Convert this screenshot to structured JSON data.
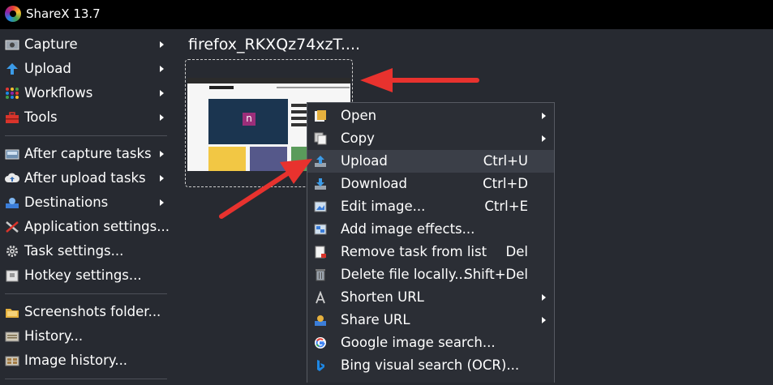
{
  "window": {
    "title": "ShareX 13.7"
  },
  "main_menu": [
    {
      "label": "Capture",
      "icon": "camera-icon",
      "submenu": true
    },
    {
      "label": "Upload",
      "icon": "upload-arrow-icon",
      "submenu": true
    },
    {
      "label": "Workflows",
      "icon": "workflows-grid-icon",
      "submenu": true
    },
    {
      "label": "Tools",
      "icon": "toolbox-icon",
      "submenu": true
    },
    {
      "label": "After capture tasks",
      "icon": "after-capture-icon",
      "submenu": true
    },
    {
      "label": "After upload tasks",
      "icon": "cloud-upload-icon",
      "submenu": true
    },
    {
      "label": "Destinations",
      "icon": "destinations-icon",
      "submenu": true
    },
    {
      "label": "Application settings...",
      "icon": "wrench-screwdriver-icon",
      "submenu": false
    },
    {
      "label": "Task settings...",
      "icon": "gear-icon",
      "submenu": false
    },
    {
      "label": "Hotkey settings...",
      "icon": "keyboard-icon",
      "submenu": false
    },
    {
      "label": "Screenshots folder...",
      "icon": "folder-icon",
      "submenu": false
    },
    {
      "label": "History...",
      "icon": "history-icon",
      "submenu": false
    },
    {
      "label": "Image history...",
      "icon": "image-history-icon",
      "submenu": false
    }
  ],
  "thumbnail": {
    "filename": "firefox_RKXQz74xzT....",
    "preview_brand": "Nerds Chalk",
    "preview_letter": "n"
  },
  "context_menu": [
    {
      "label": "Open",
      "shortcut": "",
      "icon": "open-folder-icon",
      "submenu": true
    },
    {
      "label": "Copy",
      "shortcut": "",
      "icon": "copy-icon",
      "submenu": true
    },
    {
      "label": "Upload",
      "shortcut": "Ctrl+U",
      "icon": "upload-icon",
      "submenu": false,
      "highlighted": true
    },
    {
      "label": "Download",
      "shortcut": "Ctrl+D",
      "icon": "download-icon",
      "submenu": false
    },
    {
      "label": "Edit image...",
      "shortcut": "Ctrl+E",
      "icon": "edit-image-icon",
      "submenu": false
    },
    {
      "label": "Add image effects...",
      "shortcut": "",
      "icon": "image-effects-icon",
      "submenu": false
    },
    {
      "label": "Remove task from list",
      "shortcut": "Del",
      "icon": "remove-task-icon",
      "submenu": false
    },
    {
      "label": "Delete file locally...",
      "shortcut": "Shift+Del",
      "icon": "delete-file-icon",
      "submenu": false
    },
    {
      "label": "Shorten URL",
      "shortcut": "",
      "icon": "shorten-url-icon",
      "submenu": true
    },
    {
      "label": "Share URL",
      "shortcut": "",
      "icon": "share-url-icon",
      "submenu": true
    },
    {
      "label": "Google image search...",
      "shortcut": "",
      "icon": "google-icon",
      "submenu": false
    },
    {
      "label": "Bing visual search (OCR)...",
      "shortcut": "",
      "icon": "bing-icon",
      "submenu": false
    }
  ],
  "colors": {
    "background": "#272a31",
    "titlebar": "#000000",
    "menu": "#2b2e35",
    "highlight": "#3b3f48",
    "annotation_arrow": "#e8322e"
  }
}
